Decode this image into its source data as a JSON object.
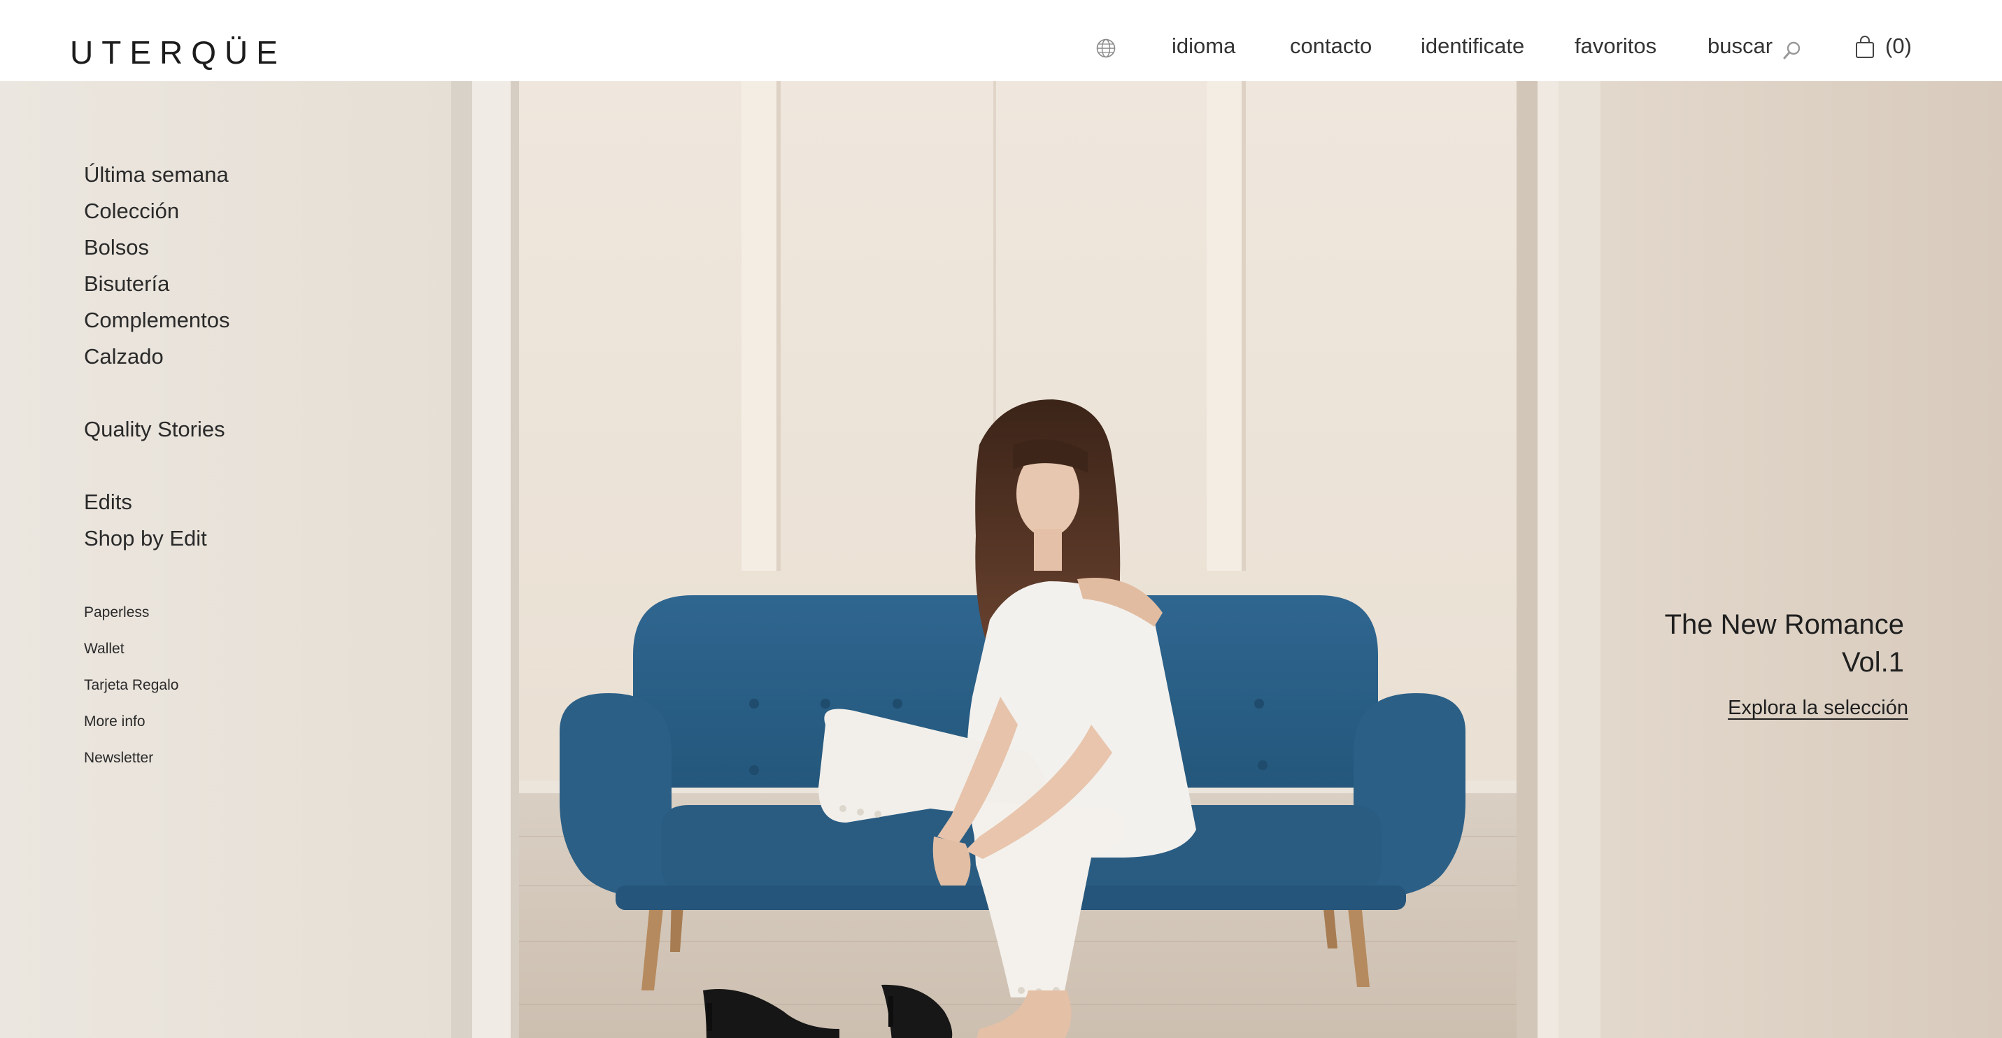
{
  "header": {
    "logo": "UTERQÜE",
    "nav": {
      "language": "idioma",
      "contact": "contacto",
      "login": "identificate",
      "favorites": "favoritos",
      "search": "buscar",
      "cart_count": "(0)"
    },
    "icons": [
      "globe-icon",
      "search-icon",
      "shopping-bag-icon"
    ]
  },
  "side_menu": {
    "primary": [
      "Última semana",
      "Colección",
      "Bolsos",
      "Bisutería",
      "Complementos",
      "Calzado"
    ],
    "stories": "Quality Stories",
    "edits": [
      "Edits",
      "Shop by Edit"
    ],
    "secondary": [
      "Paperless",
      "Wallet",
      "Tarjeta Regalo",
      "More info",
      "Newsletter"
    ]
  },
  "promo": {
    "title_line1": "The New Romance",
    "title_line2": "Vol.1",
    "cta": "Explora la selección"
  },
  "colors": {
    "sofa": "#2c5f86",
    "wall": "#ece4da",
    "text": "#2b2b2b"
  }
}
